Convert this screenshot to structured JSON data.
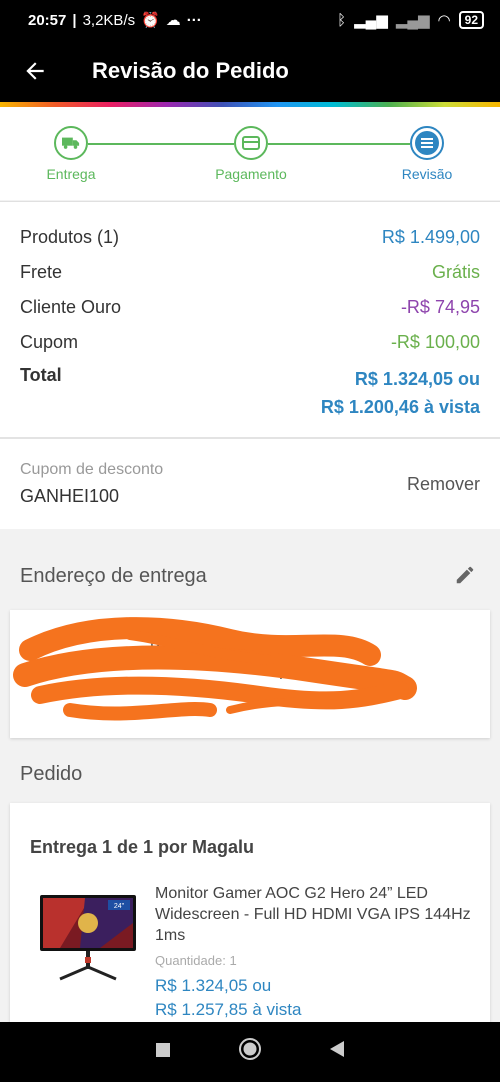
{
  "status_bar": {
    "time": "20:57",
    "speed": "3,2KB/s",
    "battery": "92"
  },
  "app_bar": {
    "title": "Revisão do Pedido"
  },
  "stepper": {
    "steps": [
      {
        "label": "Entrega"
      },
      {
        "label": "Pagamento"
      },
      {
        "label": "Revisão"
      }
    ]
  },
  "summary": {
    "products_label": "Produtos (1)",
    "products_value": "R$ 1.499,00",
    "shipping_label": "Frete",
    "shipping_value": "Grátis",
    "gold_label": "Cliente Ouro",
    "gold_value": "-R$ 74,95",
    "coupon_label": "Cupom",
    "coupon_value": "-R$ 100,00",
    "total_label": "Total",
    "total_installments": "R$ 1.324,05 ou",
    "total_cash": "R$ 1.200,46 à vista"
  },
  "coupon": {
    "label": "Cupom de desconto",
    "code": "GANHEI100",
    "remove": "Remover"
  },
  "address": {
    "title": "Endereço de entrega",
    "line1": "R. 100",
    "line2": "ARFVCD"
  },
  "order": {
    "title": "Pedido",
    "delivery": "Entrega 1 de 1 por Magalu",
    "product_name": "Monitor Gamer AOC G2 Hero 24” LED Widescreen - Full HD HDMI VGA IPS 144Hz 1ms",
    "quantity": "Quantidade:  1",
    "price_installments": "R$ 1.324,05 ou",
    "price_cash": "R$ 1.257,85 à vista",
    "product_badge": "24\""
  }
}
